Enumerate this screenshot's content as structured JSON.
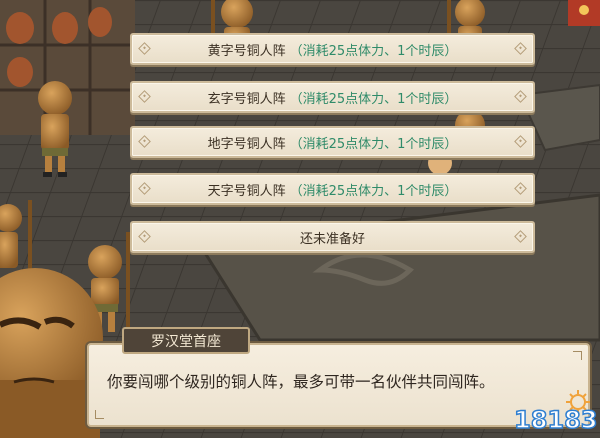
{
  "menu": {
    "options": [
      {
        "label": "黄字号铜人阵",
        "cost": "（消耗25点体力、1个时辰）"
      },
      {
        "label": "玄字号铜人阵",
        "cost": "（消耗25点体力、1个时辰）"
      },
      {
        "label": "地字号铜人阵",
        "cost": "（消耗25点体力、1个时辰）"
      },
      {
        "label": "天字号铜人阵",
        "cost": "（消耗25点体力、1个时辰）"
      },
      {
        "label": "还未准备好",
        "cost": ""
      }
    ]
  },
  "dialog": {
    "speaker": "罗汉堂首座",
    "text": "你要闯哪个级别的铜人阵，最多可带一名伙伴共同闯阵。"
  },
  "watermark": {
    "text": "18183"
  },
  "colors": {
    "panel": "#efe6d4",
    "cost_text": "#2f8b69",
    "speaker_bg": "#4f4438",
    "floor": "#4a4640"
  }
}
